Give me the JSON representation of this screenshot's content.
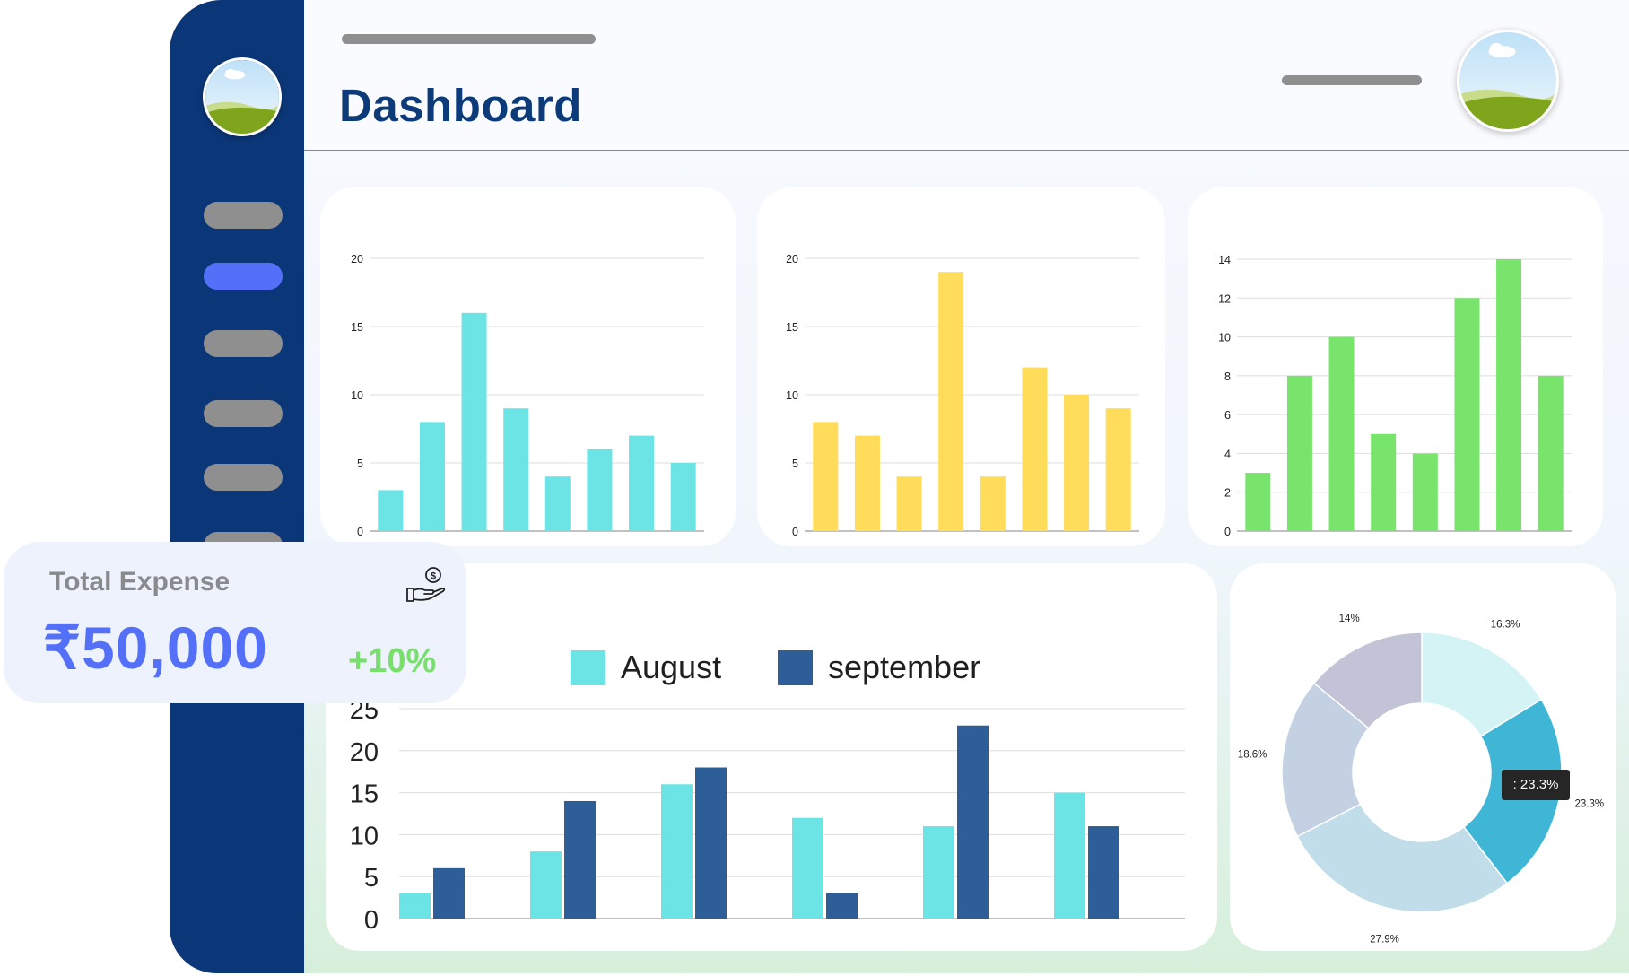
{
  "header": {
    "title": "Dashboard"
  },
  "sidebar": {
    "avatar_icon": "landscape-avatar-icon",
    "nav_items": [
      {
        "name": "nav-item-1",
        "active": false
      },
      {
        "name": "nav-item-2",
        "active": true
      },
      {
        "name": "nav-item-3",
        "active": false
      },
      {
        "name": "nav-item-4",
        "active": false
      },
      {
        "name": "nav-item-5",
        "active": false
      },
      {
        "name": "nav-item-6",
        "active": false
      }
    ]
  },
  "expense": {
    "title": "Total Expense",
    "value": "₹50,000",
    "change": "+10%",
    "icon": "hand-money-icon"
  },
  "colors": {
    "sidebar": "#0b3677",
    "accent": "#5470f8",
    "positive": "#79df6c",
    "cyan": "#6ce4e5",
    "yellow": "#ffdc5a",
    "green": "#78e46c",
    "navy": "#2e5e98"
  },
  "chart_data": [
    {
      "type": "bar",
      "categories": [
        "",
        "",
        "",
        "",
        "",
        "",
        "",
        ""
      ],
      "series": [
        {
          "values": [
            3,
            8,
            16,
            9,
            4,
            6,
            7,
            5
          ],
          "color": "#6ce4e5"
        }
      ],
      "yticks": [
        "0",
        "5",
        "10",
        "15",
        "20"
      ],
      "ylim": [
        0,
        20
      ],
      "grid": true
    },
    {
      "type": "bar",
      "categories": [
        "",
        "",
        "",
        "",
        "",
        "",
        "",
        ""
      ],
      "series": [
        {
          "values": [
            8,
            7,
            4,
            19,
            4,
            12,
            10,
            9
          ],
          "color": "#ffdc5a"
        }
      ],
      "yticks": [
        "0",
        "5",
        "10",
        "15",
        "20"
      ],
      "ylim": [
        0,
        20
      ],
      "grid": true
    },
    {
      "type": "bar",
      "categories": [
        "",
        "",
        "",
        "",
        "",
        "",
        "",
        ""
      ],
      "series": [
        {
          "values": [
            3,
            8,
            10,
            5,
            4,
            12,
            14,
            8
          ],
          "color": "#78e46c"
        }
      ],
      "yticks": [
        "0",
        "2",
        "4",
        "6",
        "8",
        "10",
        "12",
        "14"
      ],
      "ylim": [
        0,
        14
      ],
      "grid": true
    },
    {
      "type": "bar",
      "categories": [
        "",
        "",
        "",
        "",
        "",
        ""
      ],
      "series": [
        {
          "name": "August",
          "values": [
            3,
            8,
            16,
            12,
            11,
            15
          ],
          "color": "#6ce4e5"
        },
        {
          "name": "september",
          "values": [
            6,
            14,
            18,
            3,
            23,
            11
          ],
          "color": "#2e5e98"
        }
      ],
      "yticks": [
        "0",
        "5",
        "10",
        "15",
        "20",
        "25"
      ],
      "ylim": [
        0,
        25
      ],
      "legend": "top",
      "grid": true
    },
    {
      "type": "pie",
      "donut": true,
      "slices": [
        {
          "label": "16.3%",
          "value": 16.3,
          "color": "#d3f3f5"
        },
        {
          "label": "23.3%",
          "value": 23.3,
          "color": "#40b6d6"
        },
        {
          "label": "27.9%",
          "value": 27.9,
          "color": "#c0dde9"
        },
        {
          "label": "18.6%",
          "value": 18.6,
          "color": "#c4d1e3"
        },
        {
          "label": "14%",
          "value": 14,
          "color": "#c2c3d6"
        }
      ],
      "tooltip": ": 23.3%"
    }
  ]
}
